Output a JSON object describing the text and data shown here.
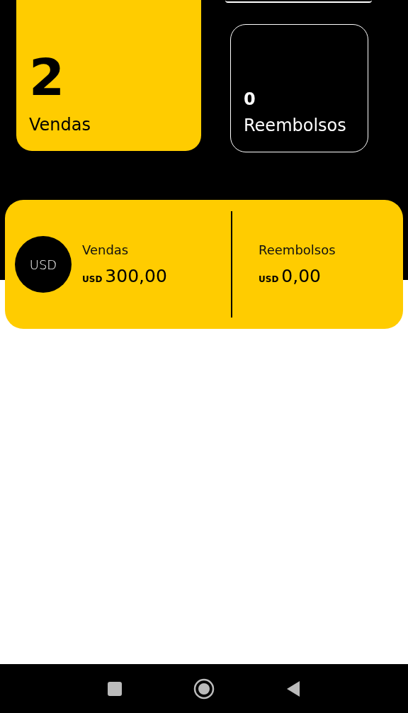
{
  "stat_cards": [
    {
      "kind": "filled",
      "value": "2",
      "label": "Vendas"
    },
    {
      "kind": "outlined",
      "value": "0",
      "label": "Reembolsos"
    }
  ],
  "summary": {
    "currency_badge": "USD",
    "items": [
      {
        "label": "Vendas",
        "currency": "USD",
        "amount": "300,00"
      },
      {
        "label": "Reembolsos",
        "currency": "USD",
        "amount": "0,00"
      }
    ]
  }
}
